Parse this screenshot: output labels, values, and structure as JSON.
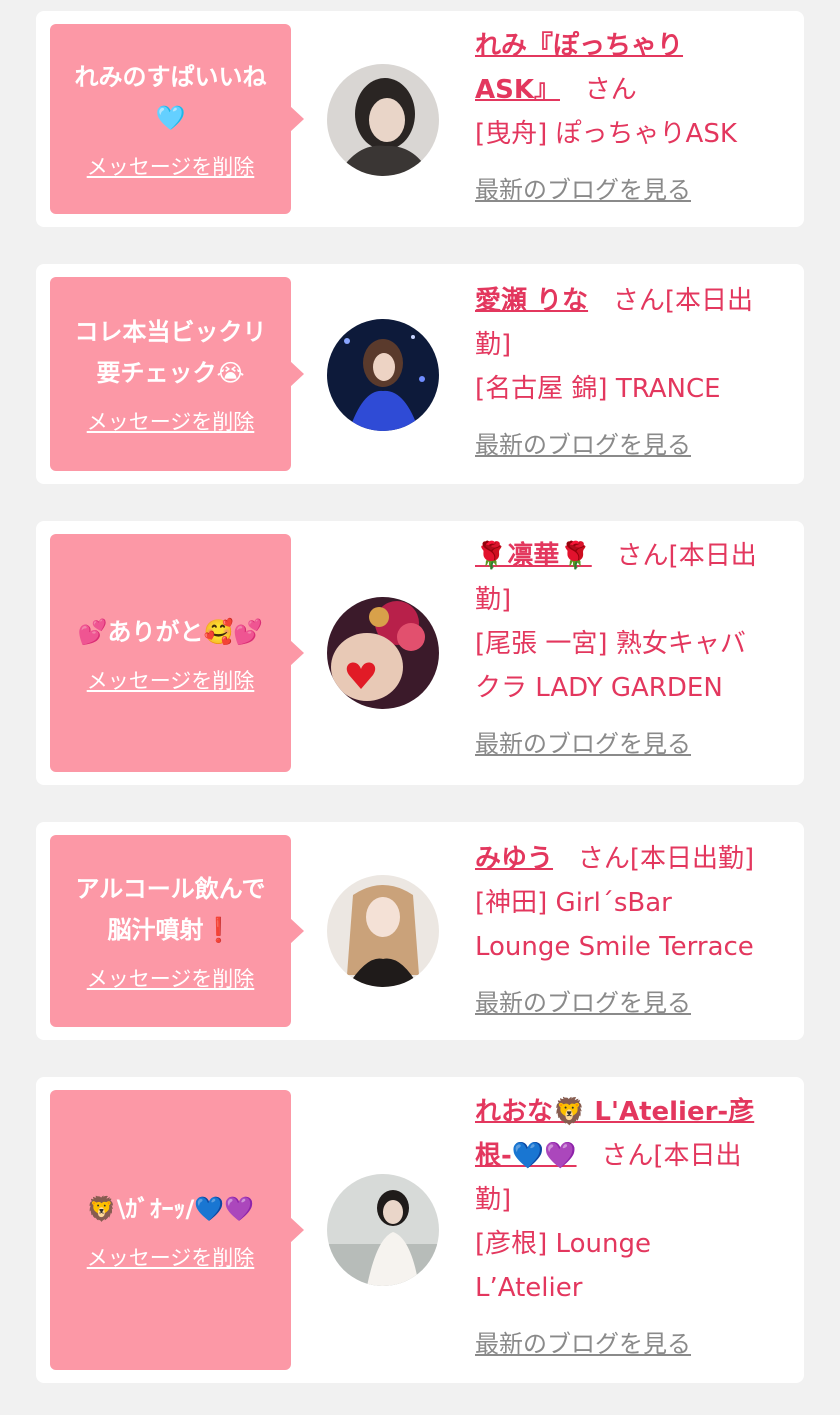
{
  "messages": [
    {
      "bubble_lines": [
        "れみのすぱいいね",
        "🩵"
      ],
      "delete_label": "メッセージを削除",
      "name_lines": [
        "れみ『ぽっちゃり",
        "ASK』"
      ],
      "san_label": "さん",
      "info_lines": [
        "[曳舟] ぽっちゃりASK"
      ],
      "blog_label": "最新のブログを見る"
    },
    {
      "bubble_lines": [
        "コレ本当ビックリ",
        "要チェック😭"
      ],
      "delete_label": "メッセージを削除",
      "name_lines": [
        "愛瀬 りな"
      ],
      "san_label": "さん[本日出",
      "san_line2": "勤]",
      "info_lines": [
        "[名古屋 錦] TRANCE"
      ],
      "blog_label": "最新のブログを見る"
    },
    {
      "bubble_lines": [
        "💕ありがと🥰💕"
      ],
      "delete_label": "メッセージを削除",
      "name_lines": [
        "🌹凛華🌹"
      ],
      "san_label": "さん[本日出",
      "san_line2": "勤]",
      "info_lines": [
        "[尾張 一宮] 熟女キャバ",
        "クラ LADY GARDEN"
      ],
      "blog_label": "最新のブログを見る"
    },
    {
      "bubble_lines": [
        "アルコール飲んで",
        "脳汁噴射❗️"
      ],
      "delete_label": "メッセージを削除",
      "name_lines": [
        "みゆう"
      ],
      "san_label": "さん[本日出勤]",
      "info_lines": [
        "[神田] Girl´sBar",
        "Lounge Smile Terrace"
      ],
      "blog_label": "最新のブログを見る"
    },
    {
      "bubble_lines": [
        "🦁\\ｶﾞｵｰｯ/💙💜"
      ],
      "delete_label": "メッセージを削除",
      "name_lines": [
        "れおな🦁 L'Atelier-彦",
        "根-💙💜"
      ],
      "san_label": "さん[本日出",
      "san_line2": "勤]",
      "info_lines": [
        "[彦根] Lounge",
        "L’Atelier"
      ],
      "blog_label": "最新のブログを見る"
    }
  ],
  "colors": {
    "bubble": "#fc98a6",
    "accent": "#e3375e",
    "muted_link": "#8a8a8a",
    "page_bg": "#f1f1f1"
  },
  "icons": [
    "avatar-photo"
  ]
}
